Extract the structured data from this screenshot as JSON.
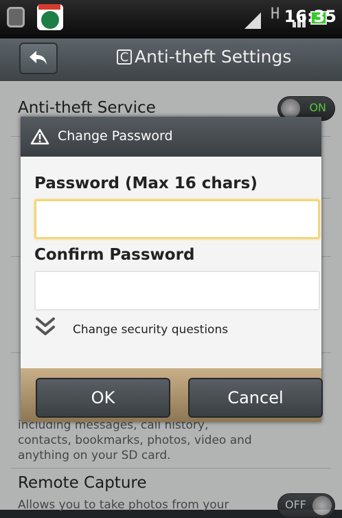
{
  "status_bar": {
    "time": "16:35",
    "network_label": "H",
    "icons": [
      "settings-icon",
      "comodo-app-icon",
      "signal-icon",
      "bars-icon",
      "battery-icon"
    ],
    "battery_color": "#38c82c"
  },
  "header": {
    "title": "Anti-theft Settings",
    "title_icon_glyph": "C"
  },
  "settings": {
    "items": [
      {
        "title": "Anti-theft Service",
        "toggle_label": "ON"
      },
      {
        "description": "including messages, call history,\ncontacts, bookmarks, photos, video and\nanything on your SD card."
      },
      {
        "title": "Remote Capture",
        "description": "Allows you to take photos from your",
        "toggle_label": "OFF"
      }
    ]
  },
  "dialog": {
    "title": "Change Password",
    "password_label": "Password (Max 16 chars)",
    "password_value": "",
    "confirm_label": "Confirm Password",
    "confirm_value": "",
    "security_questions_label": "Change security questions",
    "ok_label": "OK",
    "cancel_label": "Cancel",
    "accent_color": "#6b8b3a",
    "focus_color": "#f3d57a"
  }
}
